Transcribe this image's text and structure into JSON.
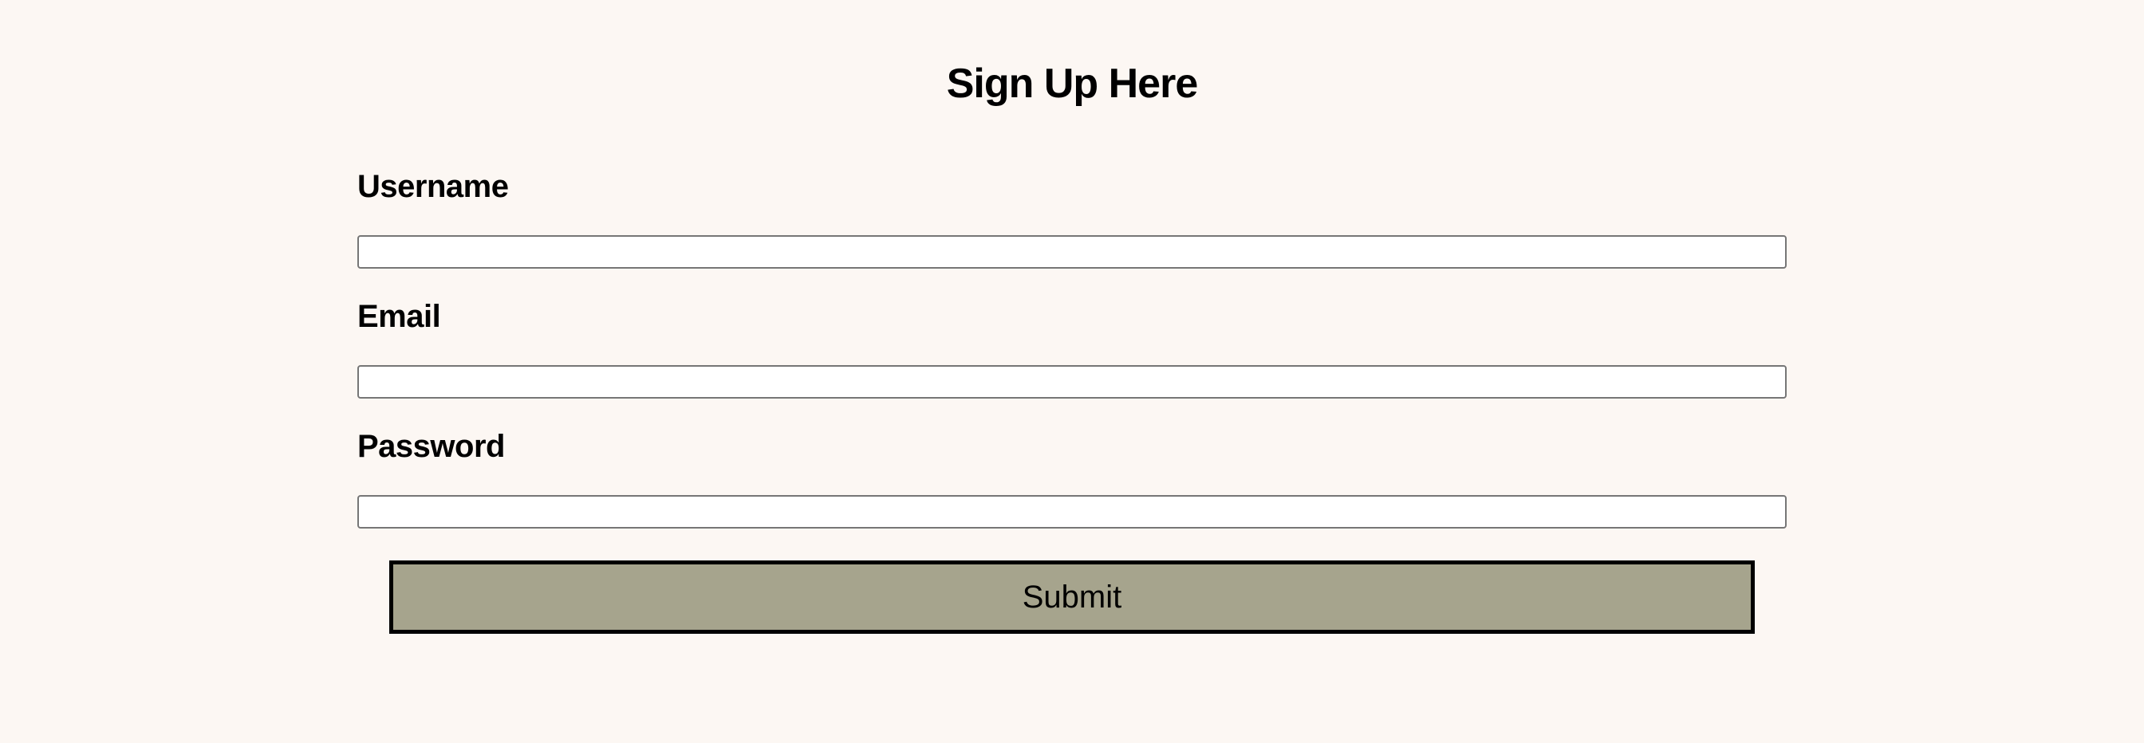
{
  "form": {
    "title": "Sign Up Here",
    "fields": [
      {
        "label": "Username",
        "value": "",
        "placeholder": "",
        "type": "text"
      },
      {
        "label": "Email",
        "value": "",
        "placeholder": "",
        "type": "email"
      },
      {
        "label": "Password",
        "value": "",
        "placeholder": "",
        "type": "password"
      }
    ],
    "submit_label": "Submit"
  },
  "colors": {
    "page_background": "#fcf7f3",
    "button_background": "#a6a48d",
    "input_border": "#767676"
  }
}
